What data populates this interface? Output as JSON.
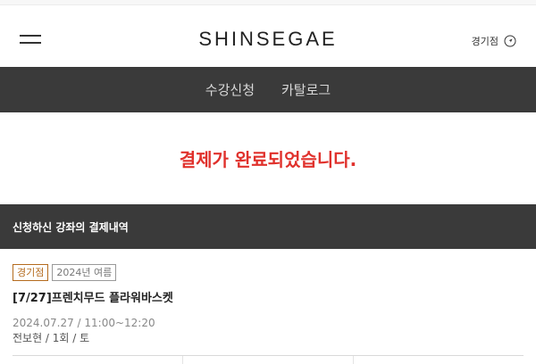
{
  "header": {
    "logo": "SHINSEGAE",
    "store": "경기점"
  },
  "nav": {
    "items": [
      "수강신청",
      "카탈로그"
    ]
  },
  "message": "결제가 완료되었습니다.",
  "section": {
    "title": "신청하신 강좌의 결제내역"
  },
  "course": {
    "badge_store": "경기점",
    "badge_season": "2024년 여름",
    "title": "[7/27]프렌치무드 플라워바스켓",
    "datetime": "2024.07.27 / 11:00~12:20",
    "detail": "전보현 / 1회 / 토"
  },
  "colors": {
    "accent_red": "#e0312c",
    "store_badge": "#b46b1e",
    "dark_bar": "#3a3a3a"
  }
}
